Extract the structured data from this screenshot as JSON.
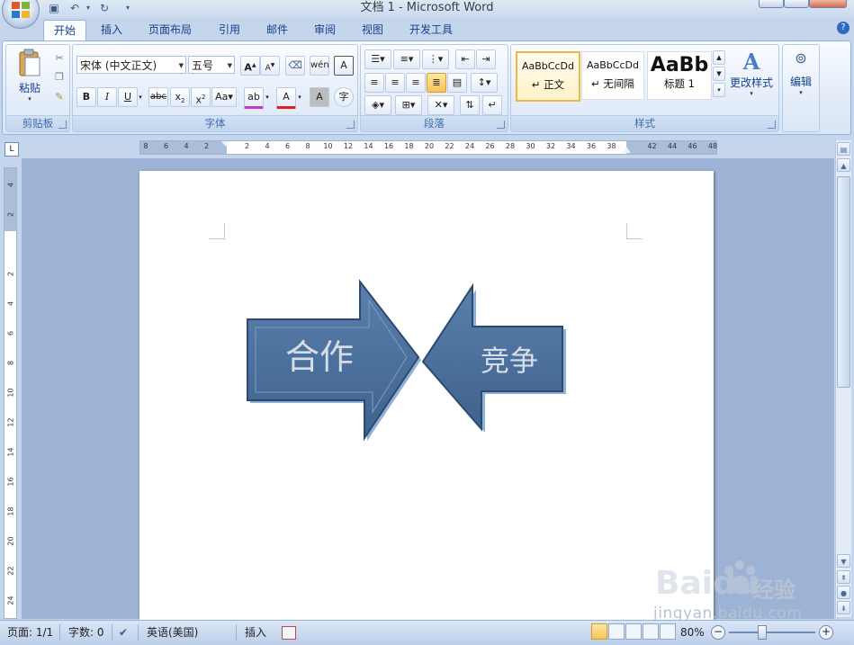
{
  "window": {
    "title": "文档 1 - Microsoft Word"
  },
  "tabs": [
    {
      "label": "开始",
      "active": true
    },
    {
      "label": "插入"
    },
    {
      "label": "页面布局"
    },
    {
      "label": "引用"
    },
    {
      "label": "邮件"
    },
    {
      "label": "审阅"
    },
    {
      "label": "视图"
    },
    {
      "label": "开发工具"
    }
  ],
  "ribbon": {
    "clipboard": {
      "label": "剪贴板",
      "paste_label": "粘贴"
    },
    "font": {
      "label": "字体",
      "font_name": "宋体 (中文正文)",
      "font_size": "五号"
    },
    "paragraph": {
      "label": "段落"
    },
    "styles": {
      "label": "样式",
      "items": [
        {
          "preview": "AaBbCcDd",
          "name": "↵ 正文",
          "selected": true
        },
        {
          "preview": "AaBbCcDd",
          "name": "↵ 无间隔"
        },
        {
          "preview": "AaBb",
          "name": "标题 1"
        }
      ],
      "change_styles_label": "更改样式"
    },
    "editing": {
      "label": "编辑"
    }
  },
  "ruler": {
    "h_ticks": [
      "8",
      "6",
      "4",
      "2",
      "",
      "2",
      "4",
      "6",
      "8",
      "10",
      "12",
      "14",
      "16",
      "18",
      "20",
      "22",
      "24",
      "26",
      "28",
      "30",
      "32",
      "34",
      "36",
      "38",
      "",
      "42",
      "44",
      "46",
      "48"
    ],
    "v_ticks": [
      "4",
      "2",
      "",
      "2",
      "4",
      "6",
      "8",
      "10",
      "12",
      "14",
      "16",
      "18",
      "20",
      "22",
      "24"
    ]
  },
  "document": {
    "arrow_left_text": "合作",
    "arrow_right_text": "竞争"
  },
  "statusbar": {
    "page": "页面: 1/1",
    "words": "字数: 0",
    "language": "英语(美国)",
    "mode": "插入",
    "zoom": "80%"
  },
  "watermark": {
    "brand": "经验",
    "url": "jingyan.baidu.com",
    "logo_text": "Baidu"
  },
  "colors": {
    "arrow_fill": "#4a6f9b",
    "arrow_dark": "#2c4a70",
    "ribbon_bg": "#dfe9f7",
    "accent": "#15428b"
  }
}
